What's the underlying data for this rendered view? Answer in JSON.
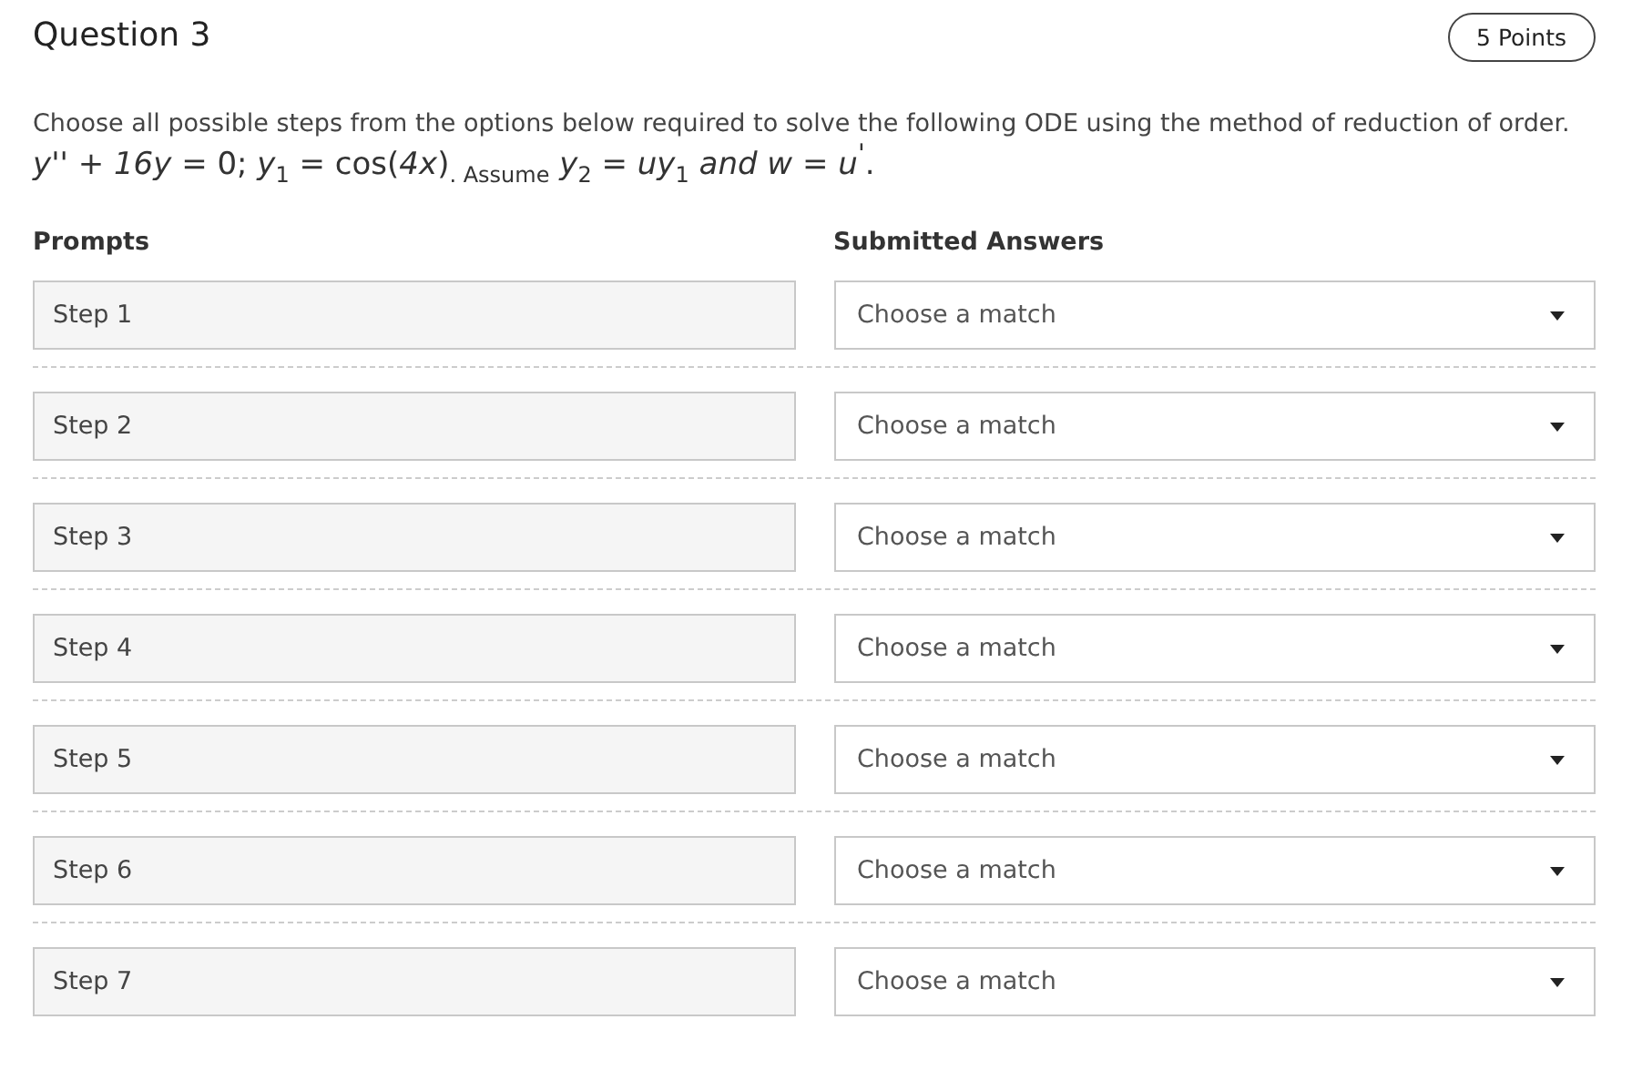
{
  "question": {
    "title": "Question 3",
    "points": "5 Points"
  },
  "instructions": "Choose all possible steps from the options below required to solve the following ODE using the method of reduction of order.",
  "equation": "*y*'' + *16y* = 0; *y*$_{1}$ = cos(*4x*)$_{. Assume}$ *y*$_{2}$ = *uy*$_{1}$ *and w* = *u*$^{'}$.",
  "columns": {
    "prompts": "Prompts",
    "answers": "Submitted Answers"
  },
  "rows": [
    {
      "prompt": "Step 1",
      "answer": {
        "placeholder": "Choose a match"
      }
    },
    {
      "prompt": "Step 2",
      "answer": {
        "placeholder": "Choose a match"
      }
    },
    {
      "prompt": "Step 3",
      "answer": {
        "placeholder": "Choose a match"
      }
    },
    {
      "prompt": "Step 4",
      "answer": {
        "placeholder": "Choose a match"
      }
    },
    {
      "prompt": "Step 5",
      "answer": {
        "placeholder": "Choose a match"
      }
    },
    {
      "prompt": "Step 6",
      "answer": {
        "placeholder": "Choose a match"
      }
    },
    {
      "prompt": "Step 7",
      "answer": {
        "placeholder": "Choose a match"
      }
    }
  ]
}
